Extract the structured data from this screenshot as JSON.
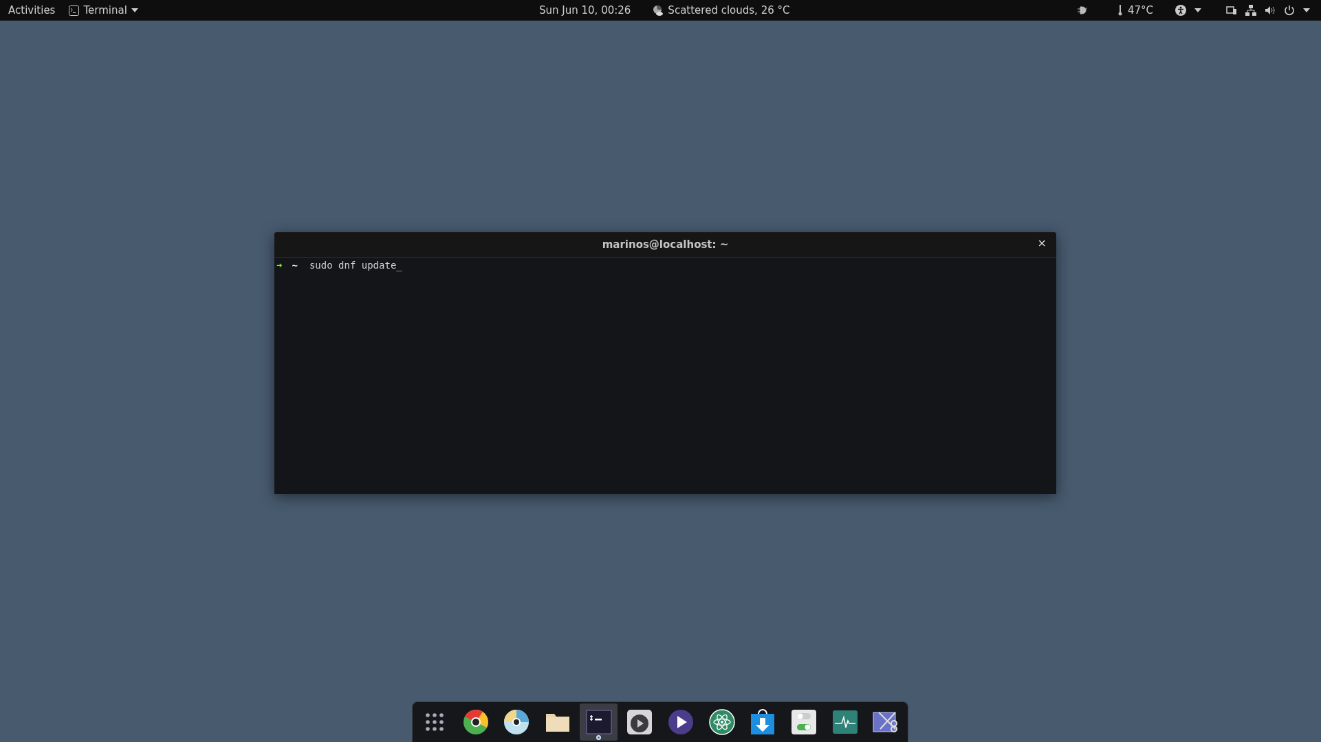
{
  "top_bar": {
    "activities": "Activities",
    "app_menu": {
      "label": "Terminal"
    },
    "clock": "Sun Jun 10, 00:26",
    "weather": "Scattered clouds, 26 °C",
    "temperature": "47°C"
  },
  "terminal": {
    "title": "marinos@localhost: ~",
    "close": "×",
    "lines": [
      {
        "arrow": "➜",
        "dir": "~",
        "command": "sudo dnf update",
        "cursor": "_"
      }
    ]
  },
  "dock": [
    {
      "kind": "apps",
      "selected": false
    },
    {
      "kind": "chrome",
      "selected": false
    },
    {
      "kind": "disc",
      "selected": false
    },
    {
      "kind": "folder",
      "selected": false
    },
    {
      "kind": "terminal",
      "selected": true
    },
    {
      "kind": "video",
      "selected": false
    },
    {
      "kind": "player",
      "selected": false
    },
    {
      "kind": "atom",
      "selected": false
    },
    {
      "kind": "download",
      "selected": false
    },
    {
      "kind": "switches",
      "selected": false
    },
    {
      "kind": "monitor",
      "selected": false
    },
    {
      "kind": "screenshot",
      "selected": false
    }
  ]
}
